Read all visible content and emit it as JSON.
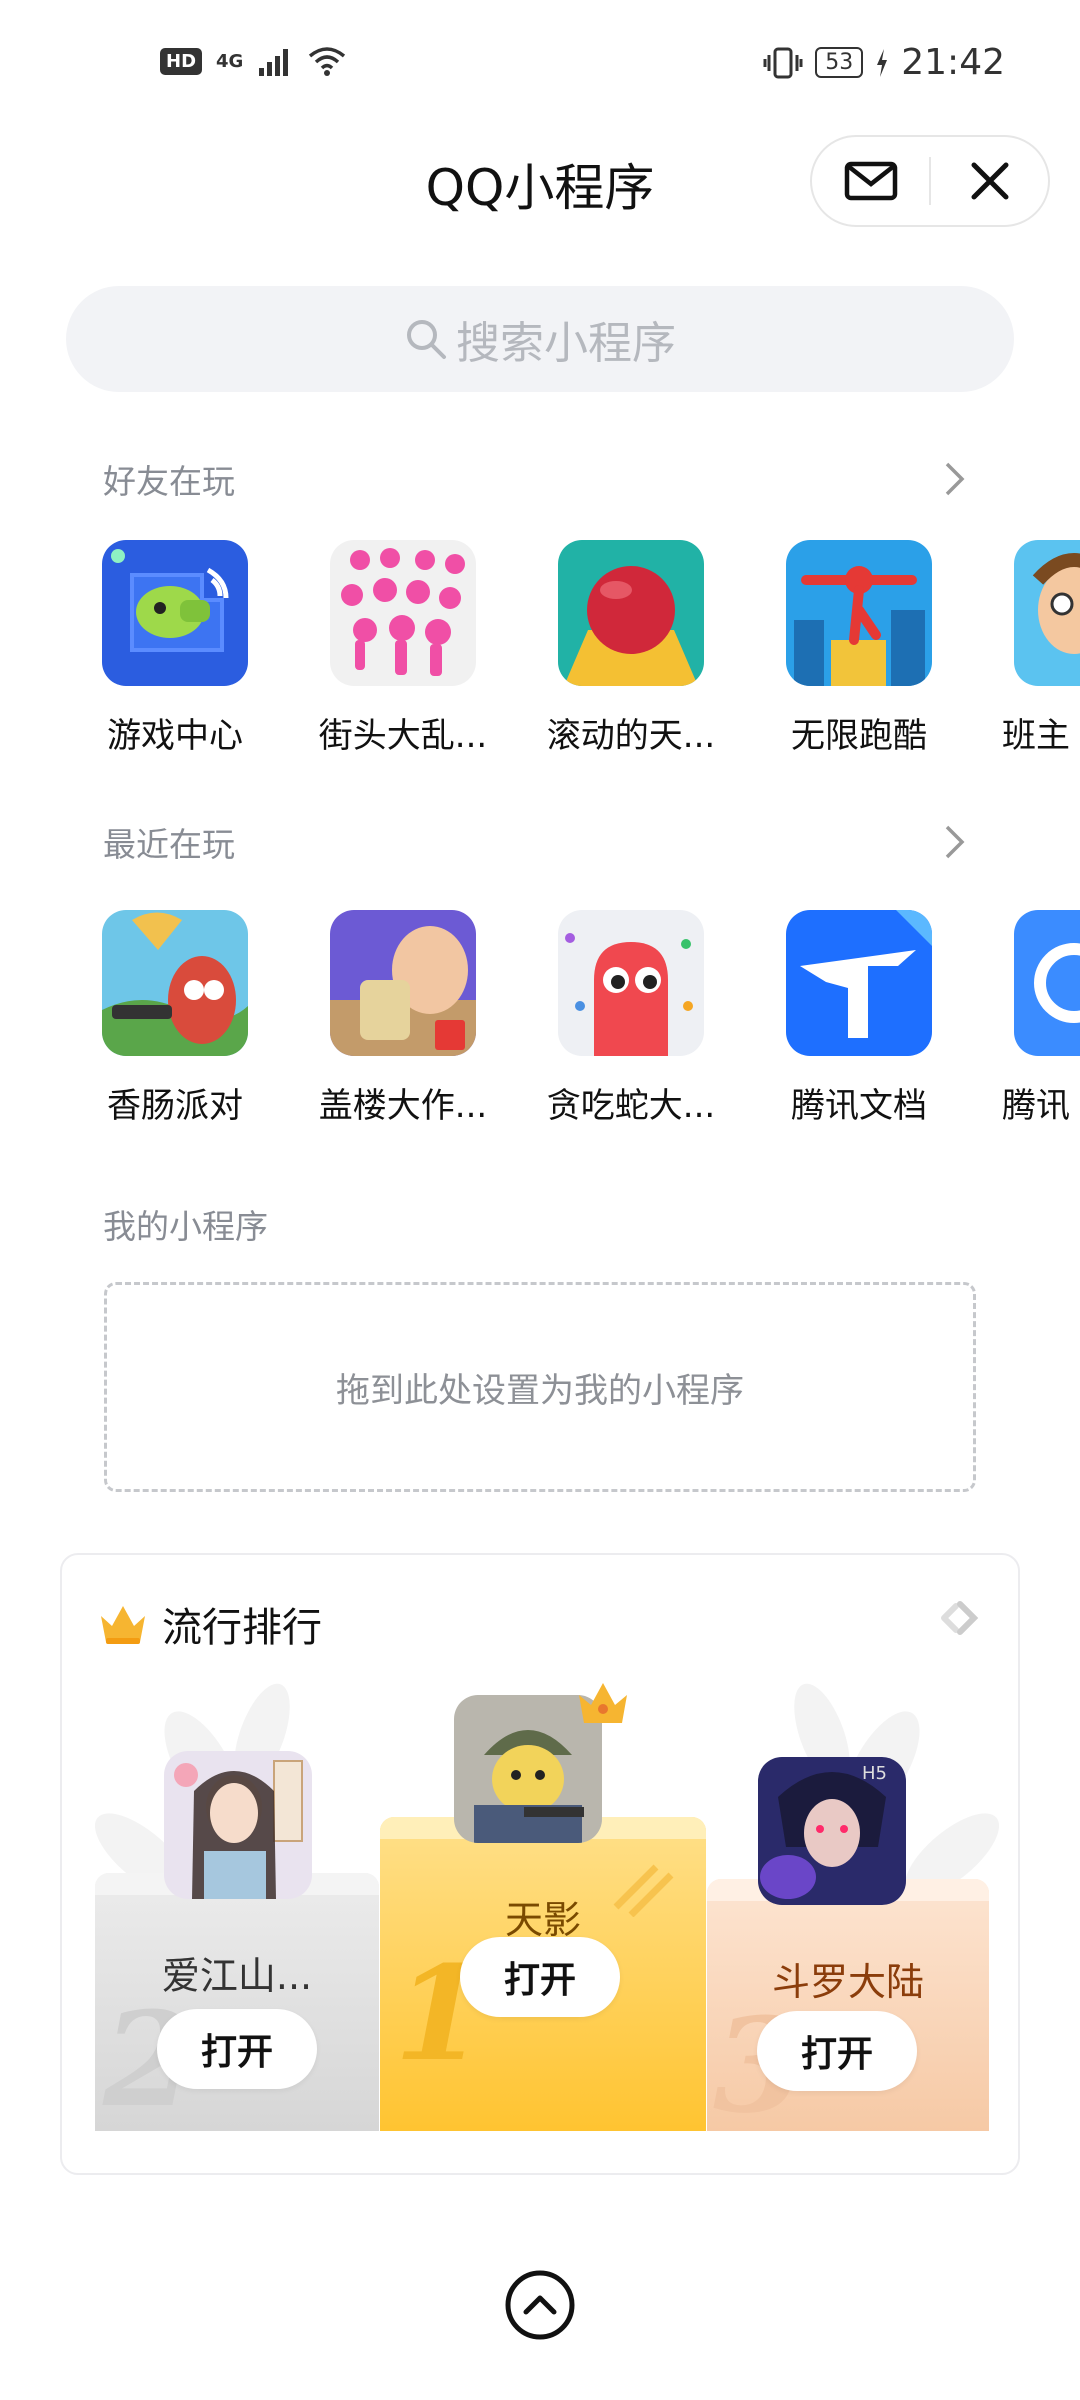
{
  "status_bar": {
    "hd": "HD",
    "network": "4G",
    "battery": "53",
    "time": "21:42"
  },
  "header": {
    "title": "QQ小程序"
  },
  "search": {
    "placeholder": "搜索小程序"
  },
  "friends_playing": {
    "title": "好友在玩",
    "apps": [
      {
        "label": "游戏中心",
        "icon": "game-center-icon"
      },
      {
        "label": "街头大乱...",
        "icon": "crowd-icon"
      },
      {
        "label": "滚动的天...",
        "icon": "rolling-ball-icon"
      },
      {
        "label": "无限跑酷",
        "icon": "parkour-icon"
      },
      {
        "label": "班主",
        "icon": "teacher-icon"
      }
    ]
  },
  "recent_playing": {
    "title": "最近在玩",
    "apps": [
      {
        "label": "香肠派对",
        "icon": "sausage-party-icon"
      },
      {
        "label": "盖楼大作...",
        "icon": "building-icon"
      },
      {
        "label": "贪吃蛇大...",
        "icon": "snake-icon"
      },
      {
        "label": "腾讯文档",
        "icon": "tencent-docs-icon"
      },
      {
        "label": "腾讯",
        "icon": "tencent-icon"
      }
    ]
  },
  "my_programs": {
    "title": "我的小程序",
    "drop_hint": "拖到此处设置为我的小程序"
  },
  "ranking": {
    "title": "流行排行",
    "items": [
      {
        "rank": "1",
        "name": "天影",
        "button": "打开"
      },
      {
        "rank": "2",
        "name": "爱江山...",
        "button": "打开"
      },
      {
        "rank": "3",
        "name": "斗罗大陆",
        "button": "打开"
      }
    ]
  },
  "colors": {
    "search_bg": "#f2f3f6",
    "gold": "#ffc431",
    "silver": "#d6d6d6",
    "bronze": "#f6c9a5"
  }
}
